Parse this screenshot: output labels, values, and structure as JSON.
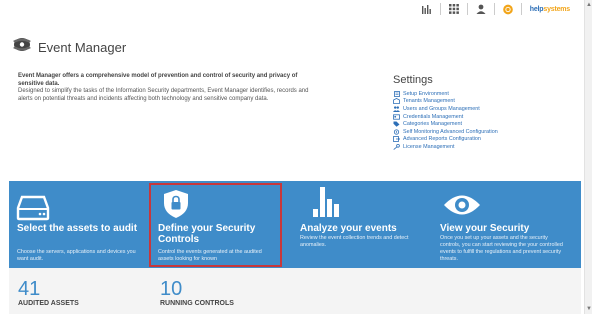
{
  "topbar": {
    "icons": [
      "bars-icon",
      "grid-icon",
      "user-icon",
      "notification-icon"
    ],
    "brand": {
      "text_a": "help",
      "text_b": "systems"
    }
  },
  "header": {
    "icon": "event-manager-icon",
    "title": "Event Manager"
  },
  "intro": {
    "heading": "Event Manager offers a comprehensive model of prevention and control of security and privacy of sensitive data.",
    "body": "Designed to simplify the tasks of the Information Security departments, Event Manager identifies, records and alerts on potential threats and incidents affecting both technology and sensitive company data."
  },
  "settings": {
    "title": "Settings",
    "items": [
      {
        "label": "Setup Environment",
        "icon": "document-icon"
      },
      {
        "label": "Tenants Management",
        "icon": "building-icon"
      },
      {
        "label": "Users and Groups Management",
        "icon": "users-icon"
      },
      {
        "label": "Credentials Management",
        "icon": "id-card-icon"
      },
      {
        "label": "Categories Management",
        "icon": "tag-icon"
      },
      {
        "label": "Self Monitoring Advanced Configuration",
        "icon": "settings-sync-icon"
      },
      {
        "label": "Advanced Reports Configuration",
        "icon": "report-icon"
      },
      {
        "label": "License Management",
        "icon": "key-icon"
      }
    ]
  },
  "cards": [
    {
      "title": "Select the assets to audit",
      "desc": "Choose the servers, applications and devices you want audit.",
      "icon": "hard-drive-icon"
    },
    {
      "title": "Define your Security Controls",
      "desc": "Control the events generated at the audited assets looking for known",
      "icon": "shield-lock-icon"
    },
    {
      "title": "Analyze your events",
      "desc": "Review the event collection trends and detect anomalies.",
      "icon": "bar-chart-icon"
    },
    {
      "title": "View your Security",
      "desc": "Once you set up your assets and the security controls, you can start reviewing the your controlled events to fulfill the regulations and prevent security threats.",
      "icon": "eye-icon"
    }
  ],
  "stats": [
    {
      "value": "41",
      "label": "AUDITED ASSETS"
    },
    {
      "value": "10",
      "label": "RUNNING CONTROLS"
    }
  ],
  "colors": {
    "panel": "#3f8cc9",
    "highlight": "#c8373b",
    "link": "#2d6fb7"
  }
}
